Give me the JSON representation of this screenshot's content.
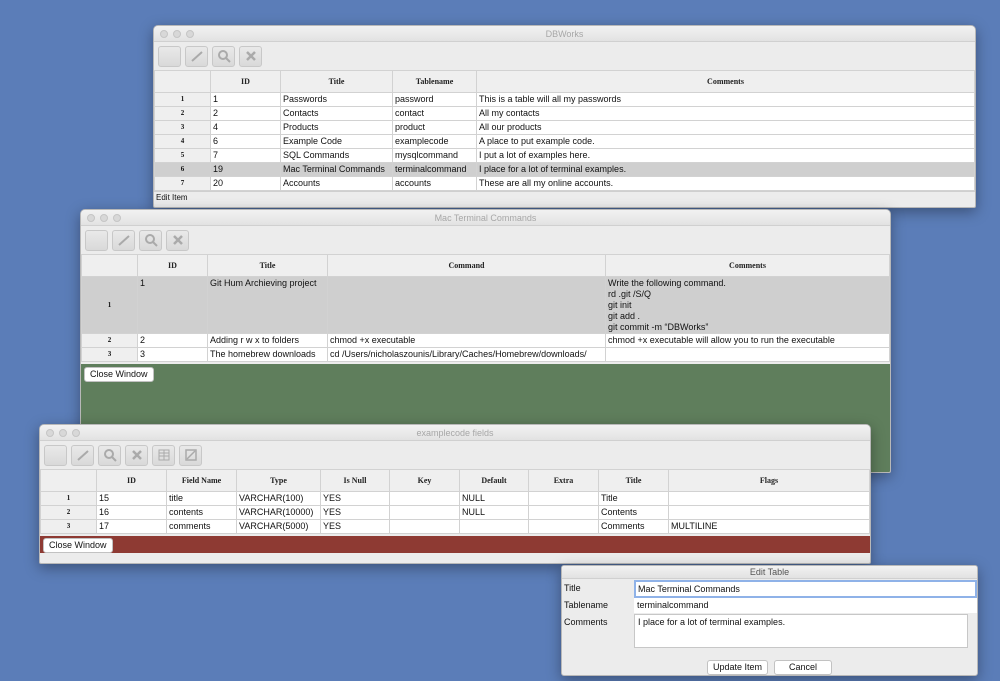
{
  "win_main": {
    "title": "DBWorks",
    "columns": [
      "",
      "ID",
      "Title",
      "Tablename",
      "Comments"
    ],
    "rows": [
      [
        "1",
        "1",
        "Passwords",
        "password",
        "This is a table will all my passwords"
      ],
      [
        "2",
        "2",
        "Contacts",
        "contact",
        "All my contacts"
      ],
      [
        "3",
        "4",
        "Products",
        "product",
        "All our products"
      ],
      [
        "4",
        "6",
        "Example Code",
        "examplecode",
        "A place to put example code."
      ],
      [
        "5",
        "7",
        "SQL Commands",
        "mysqlcommand",
        "I put a lot of examples here."
      ],
      [
        "6",
        "19",
        "Mac Terminal Commands",
        "terminalcommand",
        "I place for a lot of terminal examples."
      ],
      [
        "7",
        "20",
        "Accounts",
        "accounts",
        "These are all my online accounts."
      ]
    ],
    "status": "Edit Item"
  },
  "win_terminal": {
    "title": "Mac Terminal Commands",
    "columns": [
      "",
      "ID",
      "Title",
      "Command",
      "Comments"
    ],
    "rows": [
      [
        "1",
        "1",
        "Git Hum Archieving project",
        "",
        "Write the following command.\nrd .git /S/Q\ngit init\ngit add .\ngit commit -m “DBWorks”"
      ],
      [
        "2",
        "2",
        "Adding r w x to folders",
        "chmod +x executable",
        "chmod +x executable will allow you to run the executable"
      ],
      [
        "3",
        "3",
        "The homebrew downloads",
        "cd /Users/nicholaszounis/Library/Caches/Homebrew/downloads/",
        ""
      ]
    ],
    "close_label": "Close Window"
  },
  "win_fields": {
    "title": "examplecode fields",
    "columns": [
      "",
      "ID",
      "Field Name",
      "Type",
      "Is Null",
      "Key",
      "Default",
      "Extra",
      "Title",
      "Flags"
    ],
    "rows": [
      [
        "1",
        "15",
        "title",
        "VARCHAR(100)",
        "YES",
        "",
        "NULL",
        "",
        "Title",
        ""
      ],
      [
        "2",
        "16",
        "contents",
        "VARCHAR(10000)",
        "YES",
        "",
        "NULL",
        "",
        "Contents",
        ""
      ],
      [
        "3",
        "17",
        "comments",
        "VARCHAR(5000)",
        "YES",
        "",
        "",
        "",
        "Comments",
        "MULTILINE"
      ]
    ],
    "close_label": "Close Window"
  },
  "edit_table": {
    "title": "Edit Table",
    "title_label": "Title",
    "title_value": "Mac Terminal Commands",
    "tablename_label": "Tablename",
    "tablename_value": "terminalcommand",
    "comments_label": "Comments",
    "comments_value": "I place for a lot of terminal examples.",
    "update_label": "Update Item",
    "cancel_label": "Cancel"
  },
  "icons": {
    "toolbar": [
      "new-icon",
      "edit-icon",
      "search-icon",
      "delete-icon"
    ],
    "toolbar_extra": [
      "table-icon",
      "image-icon"
    ]
  }
}
